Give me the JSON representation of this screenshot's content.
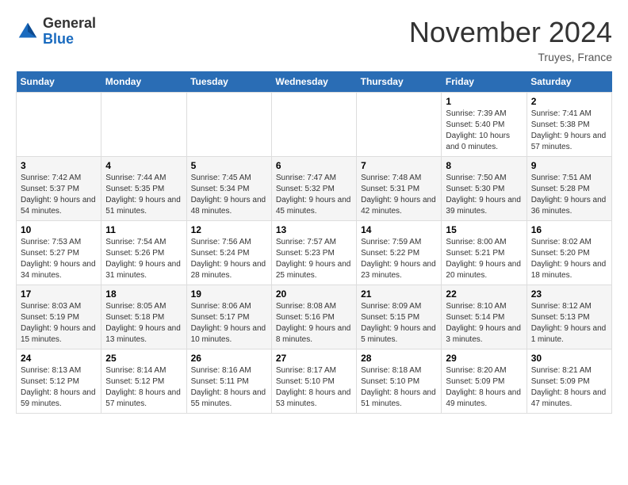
{
  "header": {
    "logo": {
      "line1": "General",
      "line2": "Blue"
    },
    "title": "November 2024",
    "location": "Truyes, France"
  },
  "weekdays": [
    "Sunday",
    "Monday",
    "Tuesday",
    "Wednesday",
    "Thursday",
    "Friday",
    "Saturday"
  ],
  "weeks": [
    [
      null,
      null,
      null,
      null,
      null,
      {
        "day": "1",
        "sunrise": "Sunrise: 7:39 AM",
        "sunset": "Sunset: 5:40 PM",
        "daylight": "Daylight: 10 hours and 0 minutes."
      },
      {
        "day": "2",
        "sunrise": "Sunrise: 7:41 AM",
        "sunset": "Sunset: 5:38 PM",
        "daylight": "Daylight: 9 hours and 57 minutes."
      }
    ],
    [
      {
        "day": "3",
        "sunrise": "Sunrise: 7:42 AM",
        "sunset": "Sunset: 5:37 PM",
        "daylight": "Daylight: 9 hours and 54 minutes."
      },
      {
        "day": "4",
        "sunrise": "Sunrise: 7:44 AM",
        "sunset": "Sunset: 5:35 PM",
        "daylight": "Daylight: 9 hours and 51 minutes."
      },
      {
        "day": "5",
        "sunrise": "Sunrise: 7:45 AM",
        "sunset": "Sunset: 5:34 PM",
        "daylight": "Daylight: 9 hours and 48 minutes."
      },
      {
        "day": "6",
        "sunrise": "Sunrise: 7:47 AM",
        "sunset": "Sunset: 5:32 PM",
        "daylight": "Daylight: 9 hours and 45 minutes."
      },
      {
        "day": "7",
        "sunrise": "Sunrise: 7:48 AM",
        "sunset": "Sunset: 5:31 PM",
        "daylight": "Daylight: 9 hours and 42 minutes."
      },
      {
        "day": "8",
        "sunrise": "Sunrise: 7:50 AM",
        "sunset": "Sunset: 5:30 PM",
        "daylight": "Daylight: 9 hours and 39 minutes."
      },
      {
        "day": "9",
        "sunrise": "Sunrise: 7:51 AM",
        "sunset": "Sunset: 5:28 PM",
        "daylight": "Daylight: 9 hours and 36 minutes."
      }
    ],
    [
      {
        "day": "10",
        "sunrise": "Sunrise: 7:53 AM",
        "sunset": "Sunset: 5:27 PM",
        "daylight": "Daylight: 9 hours and 34 minutes."
      },
      {
        "day": "11",
        "sunrise": "Sunrise: 7:54 AM",
        "sunset": "Sunset: 5:26 PM",
        "daylight": "Daylight: 9 hours and 31 minutes."
      },
      {
        "day": "12",
        "sunrise": "Sunrise: 7:56 AM",
        "sunset": "Sunset: 5:24 PM",
        "daylight": "Daylight: 9 hours and 28 minutes."
      },
      {
        "day": "13",
        "sunrise": "Sunrise: 7:57 AM",
        "sunset": "Sunset: 5:23 PM",
        "daylight": "Daylight: 9 hours and 25 minutes."
      },
      {
        "day": "14",
        "sunrise": "Sunrise: 7:59 AM",
        "sunset": "Sunset: 5:22 PM",
        "daylight": "Daylight: 9 hours and 23 minutes."
      },
      {
        "day": "15",
        "sunrise": "Sunrise: 8:00 AM",
        "sunset": "Sunset: 5:21 PM",
        "daylight": "Daylight: 9 hours and 20 minutes."
      },
      {
        "day": "16",
        "sunrise": "Sunrise: 8:02 AM",
        "sunset": "Sunset: 5:20 PM",
        "daylight": "Daylight: 9 hours and 18 minutes."
      }
    ],
    [
      {
        "day": "17",
        "sunrise": "Sunrise: 8:03 AM",
        "sunset": "Sunset: 5:19 PM",
        "daylight": "Daylight: 9 hours and 15 minutes."
      },
      {
        "day": "18",
        "sunrise": "Sunrise: 8:05 AM",
        "sunset": "Sunset: 5:18 PM",
        "daylight": "Daylight: 9 hours and 13 minutes."
      },
      {
        "day": "19",
        "sunrise": "Sunrise: 8:06 AM",
        "sunset": "Sunset: 5:17 PM",
        "daylight": "Daylight: 9 hours and 10 minutes."
      },
      {
        "day": "20",
        "sunrise": "Sunrise: 8:08 AM",
        "sunset": "Sunset: 5:16 PM",
        "daylight": "Daylight: 9 hours and 8 minutes."
      },
      {
        "day": "21",
        "sunrise": "Sunrise: 8:09 AM",
        "sunset": "Sunset: 5:15 PM",
        "daylight": "Daylight: 9 hours and 5 minutes."
      },
      {
        "day": "22",
        "sunrise": "Sunrise: 8:10 AM",
        "sunset": "Sunset: 5:14 PM",
        "daylight": "Daylight: 9 hours and 3 minutes."
      },
      {
        "day": "23",
        "sunrise": "Sunrise: 8:12 AM",
        "sunset": "Sunset: 5:13 PM",
        "daylight": "Daylight: 9 hours and 1 minute."
      }
    ],
    [
      {
        "day": "24",
        "sunrise": "Sunrise: 8:13 AM",
        "sunset": "Sunset: 5:12 PM",
        "daylight": "Daylight: 8 hours and 59 minutes."
      },
      {
        "day": "25",
        "sunrise": "Sunrise: 8:14 AM",
        "sunset": "Sunset: 5:12 PM",
        "daylight": "Daylight: 8 hours and 57 minutes."
      },
      {
        "day": "26",
        "sunrise": "Sunrise: 8:16 AM",
        "sunset": "Sunset: 5:11 PM",
        "daylight": "Daylight: 8 hours and 55 minutes."
      },
      {
        "day": "27",
        "sunrise": "Sunrise: 8:17 AM",
        "sunset": "Sunset: 5:10 PM",
        "daylight": "Daylight: 8 hours and 53 minutes."
      },
      {
        "day": "28",
        "sunrise": "Sunrise: 8:18 AM",
        "sunset": "Sunset: 5:10 PM",
        "daylight": "Daylight: 8 hours and 51 minutes."
      },
      {
        "day": "29",
        "sunrise": "Sunrise: 8:20 AM",
        "sunset": "Sunset: 5:09 PM",
        "daylight": "Daylight: 8 hours and 49 minutes."
      },
      {
        "day": "30",
        "sunrise": "Sunrise: 8:21 AM",
        "sunset": "Sunset: 5:09 PM",
        "daylight": "Daylight: 8 hours and 47 minutes."
      }
    ]
  ]
}
